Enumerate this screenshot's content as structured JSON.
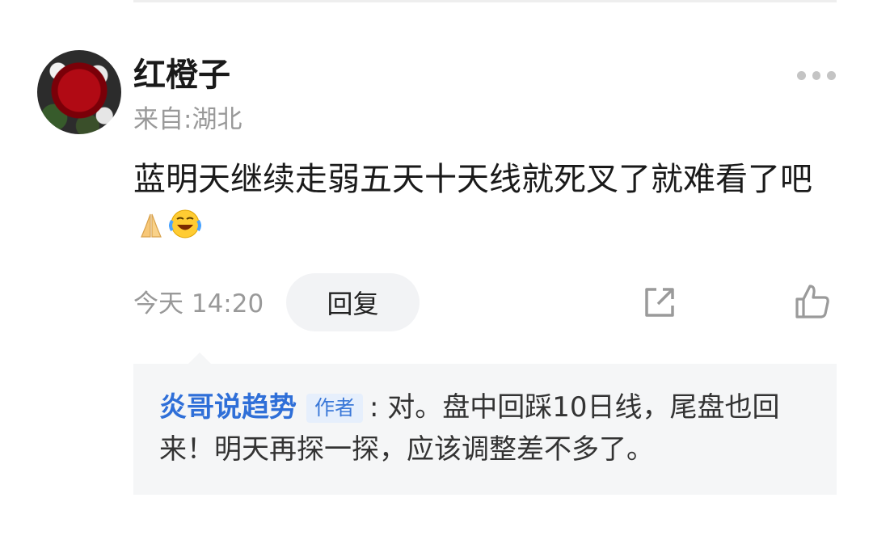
{
  "comment": {
    "username": "红橙子",
    "location": "来自:湖北",
    "text": "蓝明天继续走弱五天十天线就死叉了就难看了吧",
    "emojis": [
      "folded-hands-icon",
      "rolling-laughing-icon"
    ],
    "time": "今天 14:20",
    "reply_label": "回复"
  },
  "reply": {
    "author": "炎哥说趋势",
    "badge": "作者",
    "text": ": 对。盘中回踩10日线，尾盘也回来！明天再探一探，应该调整差不多了。"
  },
  "colors": {
    "author_blue": "#2f6fd8",
    "muted_gray": "#999999",
    "reply_bg": "#f5f6f7"
  }
}
